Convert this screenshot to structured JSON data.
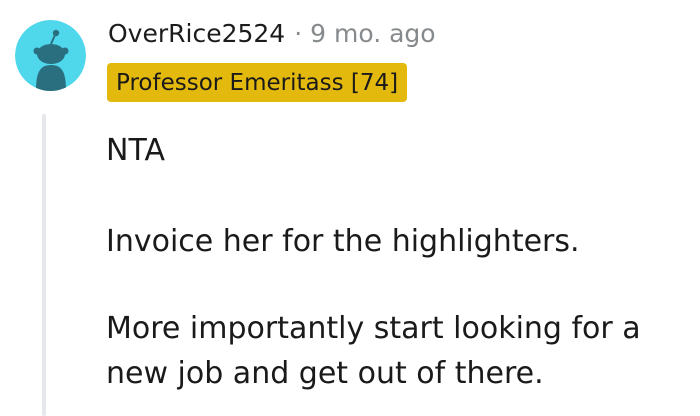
{
  "comment": {
    "username": "OverRice2524",
    "separator": "·",
    "timestamp": "9 mo. ago",
    "flair": "Professor Emeritass [74]",
    "avatar_icon": "reddit-snoo-avatar-icon",
    "colors": {
      "avatar_bg": "#4fd7ec",
      "avatar_figure": "#2a6f80",
      "flair_bg": "#e4b90d",
      "muted_text": "#878a8c",
      "thread_line": "#e5e7ea"
    },
    "paragraphs": [
      "NTA",
      "Invoice her for the highlighters.",
      "More importantly start looking for a",
      "new job and get out of there."
    ]
  }
}
